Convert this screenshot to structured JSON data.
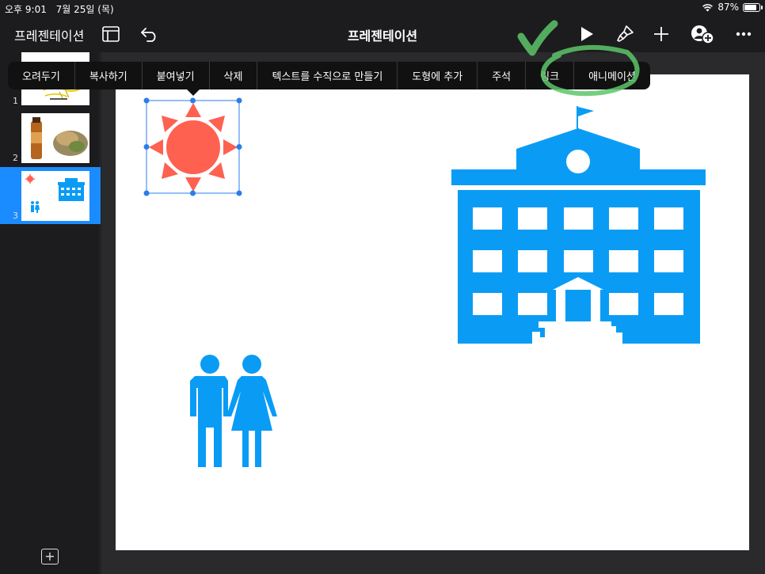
{
  "status_bar": {
    "time": "오후 9:01",
    "date": "7월 25일 (목)",
    "battery": "87%",
    "battery_level": 0.87
  },
  "toolbar": {
    "doc_name": "프레젠테이션",
    "title": "프레젠테이션",
    "icons": [
      "slides-panel-icon",
      "undo-icon",
      "play-icon",
      "brush-icon",
      "plus-icon",
      "collaborate-icon",
      "more-icon"
    ]
  },
  "sidebar": {
    "slides": [
      {
        "number": "1"
      },
      {
        "number": "2"
      },
      {
        "number": "3"
      }
    ]
  },
  "context_menu": {
    "items": [
      "오려두기",
      "복사하기",
      "붙여넣기",
      "삭제",
      "텍스트를 수직으로 만들기",
      "도형에 추가",
      "주석",
      "링크",
      "애니메이션"
    ]
  },
  "colors": {
    "sun": "#ff6150",
    "blue": "#0a9cf5",
    "selection": "#1a8cff",
    "annotation": "#5dc66a"
  }
}
